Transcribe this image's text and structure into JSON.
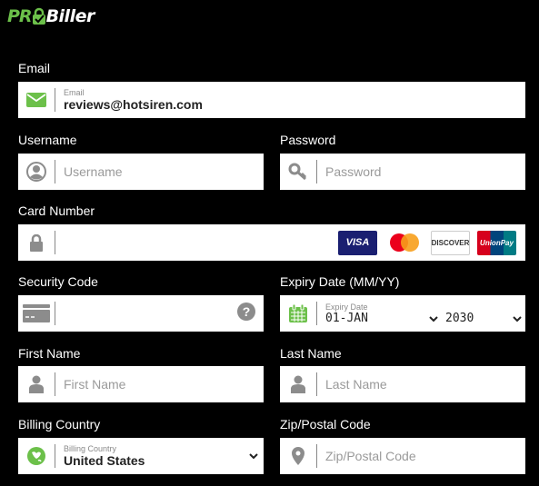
{
  "brand": {
    "pro": "PR",
    "name": "Biller",
    "accent": "#6cc04a"
  },
  "form": {
    "email": {
      "label": "Email",
      "mini_label": "Email",
      "value": "reviews@hotsiren.com",
      "icon": "envelope-icon"
    },
    "username": {
      "label": "Username",
      "placeholder": "Username",
      "icon": "user-circle-icon"
    },
    "password": {
      "label": "Password",
      "placeholder": "Password",
      "icon": "key-icon"
    },
    "card_number": {
      "label": "Card Number",
      "icon": "lock-icon",
      "accepted_cards": [
        "VISA",
        "Mastercard",
        "DISCOVER",
        "UnionPay"
      ]
    },
    "security_code": {
      "label": "Security Code",
      "icon": "credit-card-icon",
      "help_icon": "question-circle-icon"
    },
    "expiry": {
      "label": "Expiry Date (MM/YY)",
      "mini_label": "Expiry Date",
      "month": "01-JAN",
      "year": "2030",
      "icon": "calendar-icon"
    },
    "first_name": {
      "label": "First Name",
      "placeholder": "First Name",
      "icon": "user-icon"
    },
    "last_name": {
      "label": "Last Name",
      "placeholder": "Last Name",
      "icon": "user-icon"
    },
    "country": {
      "label": "Billing Country",
      "mini_label": "Billing Country",
      "value": "United States",
      "icon": "globe-icon"
    },
    "zip": {
      "label": "Zip/Postal Code",
      "placeholder": "Zip/Postal Code",
      "icon": "map-pin-icon"
    }
  }
}
